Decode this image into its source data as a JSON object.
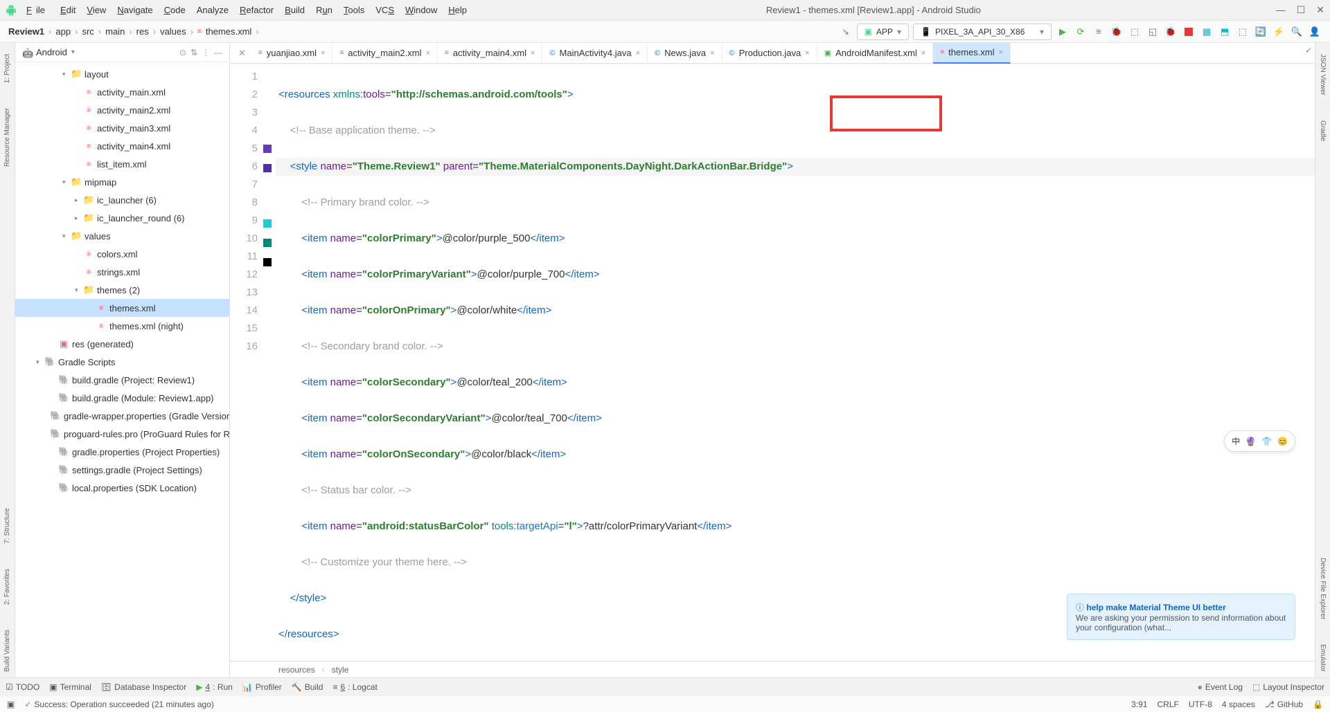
{
  "menu": {
    "file": "File",
    "edit": "Edit",
    "view": "View",
    "navigate": "Navigate",
    "code": "Code",
    "analyze": "Analyze",
    "refactor": "Refactor",
    "build": "Build",
    "run": "Run",
    "tools": "Tools",
    "vcs": "VCS",
    "window": "Window",
    "help": "Help"
  },
  "title": "Review1 - themes.xml [Review1.app] - Android Studio",
  "breadcrumbs": [
    "Review1",
    "app",
    "src",
    "main",
    "res",
    "values",
    "themes.xml"
  ],
  "runConfig": "APP",
  "device": "PIXEL_3A_API_30_X86",
  "sidebar": {
    "title": "Android",
    "layout": "layout",
    "layoutFiles": [
      "activity_main.xml",
      "activity_main2.xml",
      "activity_main3.xml",
      "activity_main4.xml",
      "list_item.xml"
    ],
    "mipmap": "mipmap",
    "mipmapDirs": [
      "ic_launcher (6)",
      "ic_launcher_round (6)"
    ],
    "values": "values",
    "valueFiles": [
      "colors.xml",
      "strings.xml"
    ],
    "themesFolder": "themes (2)",
    "themesFiles": [
      "themes.xml",
      "themes.xml (night)"
    ],
    "resGen": "res (generated)",
    "gradle": "Gradle Scripts",
    "gradleFiles": [
      "build.gradle (Project: Review1)",
      "build.gradle (Module: Review1.app)",
      "gradle-wrapper.properties (Gradle Version)",
      "proguard-rules.pro (ProGuard Rules for Rev",
      "gradle.properties (Project Properties)",
      "settings.gradle (Project Settings)",
      "local.properties (SDK Location)"
    ]
  },
  "tabs": [
    {
      "name": "yuanjiao.xml",
      "type": "xml"
    },
    {
      "name": "activity_main2.xml",
      "type": "xml"
    },
    {
      "name": "activity_main4.xml",
      "type": "xml"
    },
    {
      "name": "MainActivity4.java",
      "type": "java"
    },
    {
      "name": "News.java",
      "type": "java"
    },
    {
      "name": "Production.java",
      "type": "java"
    },
    {
      "name": "AndroidManifest.xml",
      "type": "manifest"
    },
    {
      "name": "themes.xml",
      "type": "xml",
      "active": true
    }
  ],
  "code": {
    "xmlns_url": "http://schemas.android.com/tools",
    "c1": "Base application theme.",
    "style_name": "Theme.Review1",
    "style_parent": "Theme.MaterialComponents.DayNight.DarkActionBar.Bridge",
    "c2": "Primary brand color.",
    "i1": {
      "n": "colorPrimary",
      "v": "@color/purple_500"
    },
    "i2": {
      "n": "colorPrimaryVariant",
      "v": "@color/purple_700"
    },
    "i3": {
      "n": "colorOnPrimary",
      "v": "@color/white"
    },
    "c3": "Secondary brand color.",
    "i4": {
      "n": "colorSecondary",
      "v": "@color/teal_200"
    },
    "i5": {
      "n": "colorSecondaryVariant",
      "v": "@color/teal_700"
    },
    "i6": {
      "n": "colorOnSecondary",
      "v": "@color/black"
    },
    "c4": "Status bar color.",
    "i7": {
      "n": "android:statusBarColor",
      "ta": "l",
      "v": "?attr/colorPrimaryVariant"
    },
    "c5": "Customize your theme here."
  },
  "footCrumbs": [
    "resources",
    "style"
  ],
  "leftRail": [
    "1: Project",
    "Resource Manager",
    "7: Structure",
    "2: Favorites",
    "Build Variants"
  ],
  "rightRail": [
    "JSON Viewer",
    "Gradle",
    "Device File Explorer",
    "Emulator"
  ],
  "bottomTabs": {
    "todo": "TODO",
    "terminal": "Terminal",
    "db": "Database Inspector",
    "run": "4: Run",
    "profiler": "Profiler",
    "build": "Build",
    "logcat": "6: Logcat",
    "eventlog": "Event Log",
    "layout": "Layout Inspector"
  },
  "status": {
    "msg": "Success: Operation succeeded (21 minutes ago)",
    "pos": "3:91",
    "eol": "CRLF",
    "enc": "UTF-8",
    "indent": "4 spaces",
    "git": "GitHub"
  },
  "toast": {
    "title": "help make Material Theme UI better",
    "body": "We are asking your permission to send information about your configuration (what..."
  },
  "ime": {
    "lang": "中"
  }
}
